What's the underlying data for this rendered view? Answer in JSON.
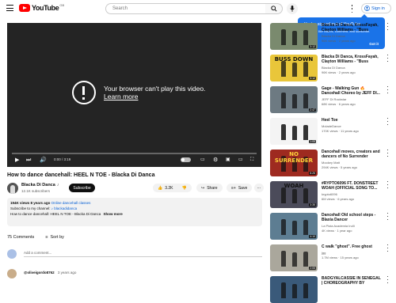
{
  "header": {
    "logo_text": "YouTube",
    "logo_country": "GB",
    "search_placeholder": "Search",
    "signin_label": "Sign in"
  },
  "signin_tooltip": {
    "title": "You're signed out of YouTube",
    "body": "Sign in to like videos, comment, and subscribe.",
    "button": "Got it"
  },
  "player": {
    "error_line1": "Your browser can't play this video.",
    "error_line2": "Learn more",
    "time": "0:00 / 3:19",
    "progress": 0.0
  },
  "video": {
    "title": "How to dance dancehall: HEEL N TOE - Blacka Di Danca",
    "channel": "Blacka Di Danca",
    "verified_mark": "♪",
    "subscribers": "12.1K subscribers",
    "subscribe_label": "Subscribe",
    "likes": "3.2K",
    "share_label": "Share",
    "save_label": "Save"
  },
  "description": {
    "views": "194K views",
    "age": "8 years ago",
    "tag": "Online dancehall classes",
    "line2": "Subscribe to my channel:",
    "line2_link": "♪ blackadidanca",
    "line3": "How to dance dancehall: HEEL N TOE - Blacka Di Danca",
    "more": "Show more"
  },
  "comments": {
    "count": "75 Comments",
    "sort_label": "Sort by",
    "add_placeholder": "Add a comment...",
    "first_author": "@oliveigordo8762",
    "first_age": "3 years ago"
  },
  "recommendations": [
    {
      "title": "Blacka Di Danca, KrossFayah, Clayton Williams - \"Buss Down\"...",
      "channel": "Blacka Di Danca",
      "views": "96K views · 2 years ago",
      "duration": "3:12",
      "thumb_color": "#7a8a6e",
      "thumb_text": ""
    },
    {
      "title": "Blacka Di Danca, KrossFayah, Clayton Williams - \"Buss Down\"...",
      "channel": "Blacka Di Danca",
      "views": "96K views · 2 years ago",
      "duration": "3:12",
      "thumb_color": "#e9c63a",
      "thumb_text": "BUSS DOWN"
    },
    {
      "title": "Gage - Walking Gun 🔥 Dancehall Choreo by JEFF DI...",
      "channel": "JEFF Di Rockstar",
      "views": "68K views · 6 years ago",
      "duration": "2:47",
      "thumb_color": "#6d7a82",
      "thumb_text": ""
    },
    {
      "title": "Heel Toe",
      "channel": "MoladeDance",
      "views": "170K views · 11 years ago",
      "duration": "1:05",
      "thumb_color": "#f4f4f4",
      "thumb_text": ""
    },
    {
      "title": "Dancehall moves, creators and dancers of No Surrender",
      "channel": "Mookey Matt",
      "views": "294K views · 5 years ago",
      "duration": "8:25",
      "thumb_color": "#9e2a20",
      "thumb_text": "NO SURRENDER"
    },
    {
      "title": "#RYPTO6096 FT. DONSTREET WOAH (OFFICIAL SONG TO...",
      "channel": "krypto6096",
      "views": "6M views · 6 years ago",
      "duration": "3:35",
      "thumb_color": "#4b4b5a",
      "thumb_text": "WOAH"
    },
    {
      "title": "Dancehall Old school steps - Blaxia Dancer",
      "channel": "La Pista Academia Irulli",
      "views": "4K views · 1 year ago",
      "duration": "4:10",
      "thumb_color": "#5d7d92",
      "thumb_text": ""
    },
    {
      "title": "C walk \"ghost\". Free ghost",
      "channel": "jgg",
      "views": "1.7M views · 15 years ago",
      "duration": "2:05",
      "thumb_color": "#aaa79c",
      "thumb_text": ""
    },
    {
      "title": "BADGYALCASSIE IN SENEGAL | CHOREOGRAPHY BY ASHLEY...",
      "channel": "",
      "views": "",
      "duration": "",
      "thumb_color": "#3a5a7a",
      "thumb_text": ""
    }
  ]
}
